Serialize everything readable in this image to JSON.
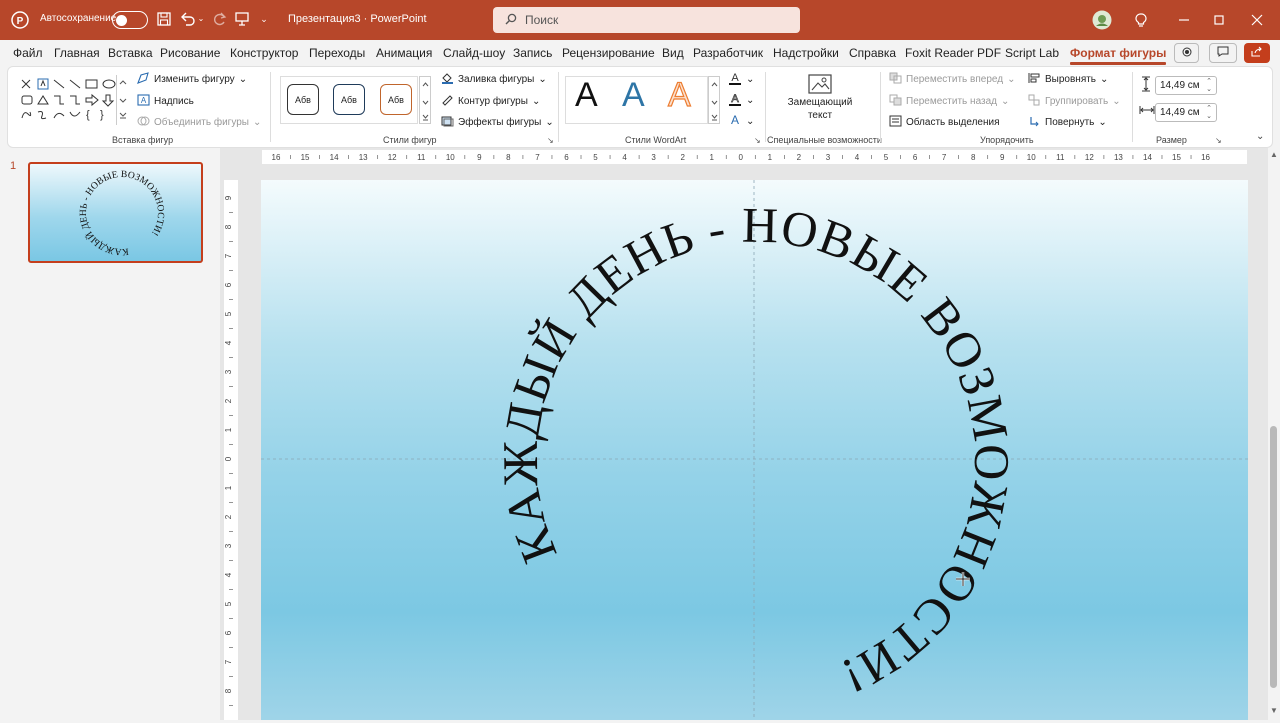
{
  "titlebar": {
    "autosave_label": "Автосохранение",
    "doc_title": "Презентация3 · PowerPoint",
    "search_placeholder": "Поиск"
  },
  "menu": {
    "tabs": [
      "Файл",
      "Главная",
      "Вставка",
      "Рисование",
      "Конструктор",
      "Переходы",
      "Анимация",
      "Слайд-шоу",
      "Запись",
      "Рецензирование",
      "Вид",
      "Разработчик",
      "Надстройки",
      "Справка",
      "Foxit Reader PDF",
      "Script Lab",
      "Формат фигуры"
    ],
    "active_tab": "Формат фигуры"
  },
  "ribbon": {
    "insert_shapes": {
      "edit_shape": "Изменить фигуру",
      "text_box": "Надпись",
      "merge_shapes": "Объединить фигуры",
      "label": "Вставка фигур"
    },
    "shape_styles": {
      "preset_text": "Абв",
      "fill": "Заливка фигуры",
      "outline": "Контур фигуры",
      "effects": "Эффекты фигуры",
      "label": "Стили фигур"
    },
    "wordart": {
      "letter": "A",
      "label": "Стили WordArt"
    },
    "accessibility": {
      "alt_text_line1": "Замещающий",
      "alt_text_line2": "текст",
      "label": "Специальные возможности"
    },
    "arrange": {
      "bring_forward": "Переместить вперед",
      "send_backward": "Переместить назад",
      "selection_pane": "Область выделения",
      "align": "Выровнять",
      "group": "Группировать",
      "rotate": "Повернуть",
      "label": "Упорядочить"
    },
    "size": {
      "height": "14,49 см",
      "width": "14,49 см",
      "label": "Размер"
    }
  },
  "slides": {
    "number": "1"
  },
  "slide": {
    "wordart_text": "КАЖДЫЙ ДЕНЬ - НОВЫЕ ВОЗМОЖНОСТИ!",
    "thumb_text": "КАЖДЫЙ ДЕНЬ - НОВЫЕ ВОЗМОЖНОСТИ!"
  },
  "ruler": {
    "h_ticks": [
      "16",
      "15",
      "14",
      "13",
      "12",
      "11",
      "10",
      "9",
      "8",
      "7",
      "6",
      "5",
      "4",
      "3",
      "2",
      "1",
      "0",
      "1",
      "2",
      "3",
      "4",
      "5",
      "6",
      "7",
      "8",
      "9",
      "10",
      "11",
      "12",
      "13",
      "14",
      "15",
      "16"
    ],
    "v_ticks": [
      "9",
      "8",
      "7",
      "6",
      "5",
      "4",
      "3",
      "2",
      "1",
      "0",
      "1",
      "2",
      "3",
      "4",
      "5",
      "6",
      "7",
      "8"
    ]
  },
  "colors": {
    "accent": "#b7472a",
    "wordart_blue": "#2e75a6",
    "wordart_orange": "#ed7d31"
  }
}
